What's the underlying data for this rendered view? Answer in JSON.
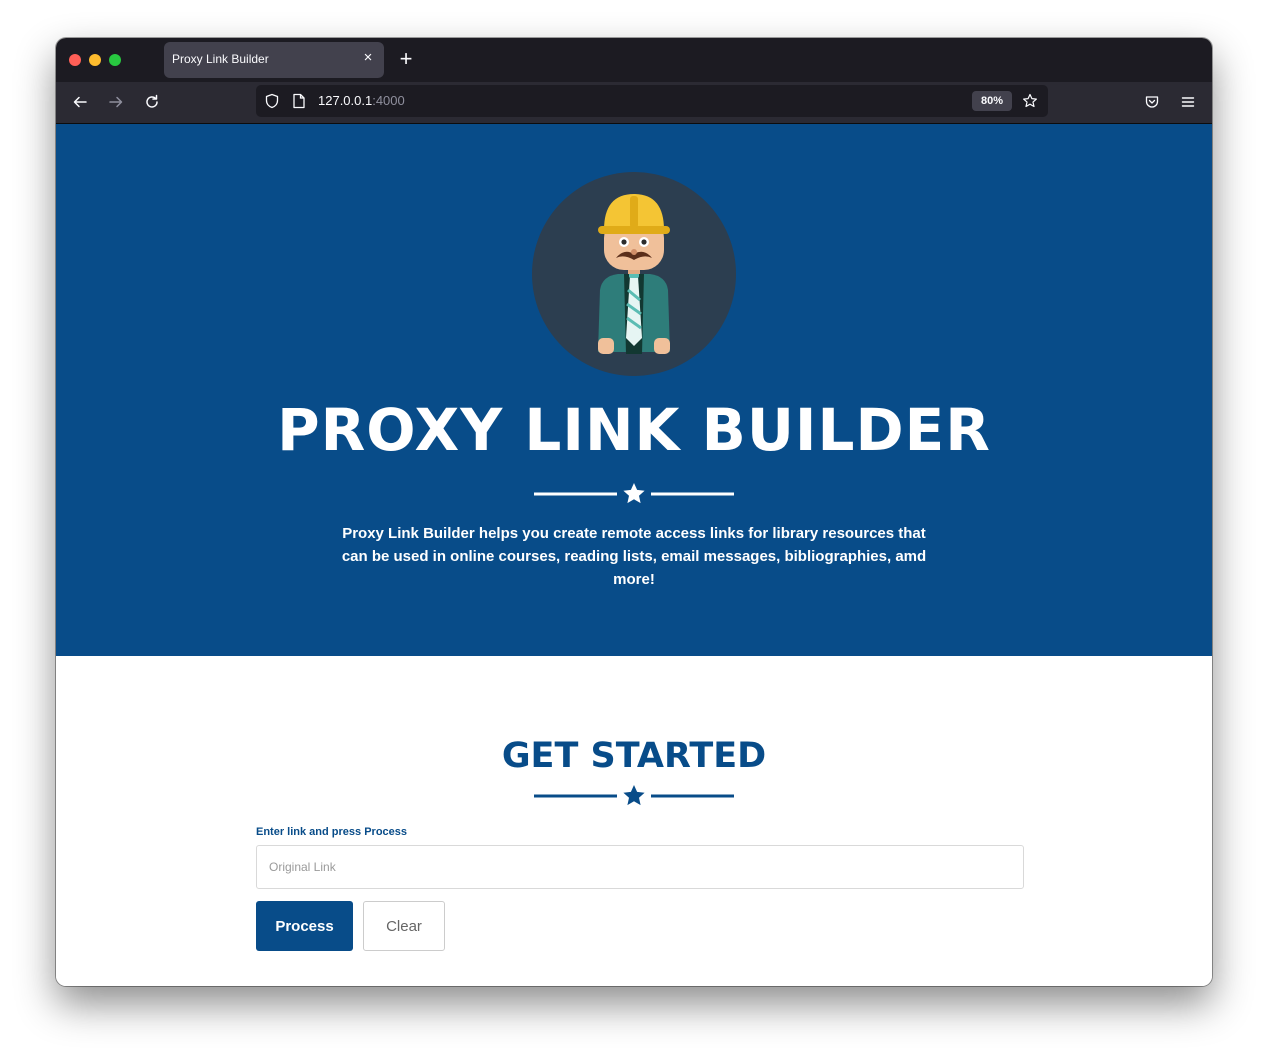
{
  "browser": {
    "tab_title": "Proxy Link Builder",
    "tab_close": "×",
    "new_tab": "+",
    "url_host": "127.0.0.1",
    "url_port": ":4000",
    "zoom": "80%"
  },
  "hero": {
    "title": "PROXY LINK BUILDER",
    "description": "Proxy Link Builder helps you create remote access links for library resources that can be used in online courses, reading lists, email messages, bibliographies, amd more!",
    "background_color": "#084c89"
  },
  "get_started": {
    "title": "GET STARTED",
    "field_label": "Enter link and press Process",
    "input_placeholder": "Original Link",
    "input_value": "",
    "process_label": "Process",
    "clear_label": "Clear"
  },
  "icons": {
    "back": "back-arrow-icon",
    "forward": "forward-arrow-icon",
    "reload": "reload-icon",
    "shield": "shield-icon",
    "page": "page-icon",
    "bookmark": "star-icon",
    "pocket": "pocket-icon",
    "menu": "hamburger-menu-icon",
    "divider": "star-icon"
  },
  "colors": {
    "accent": "#084c89",
    "browser_chrome": "#1c1b22"
  }
}
